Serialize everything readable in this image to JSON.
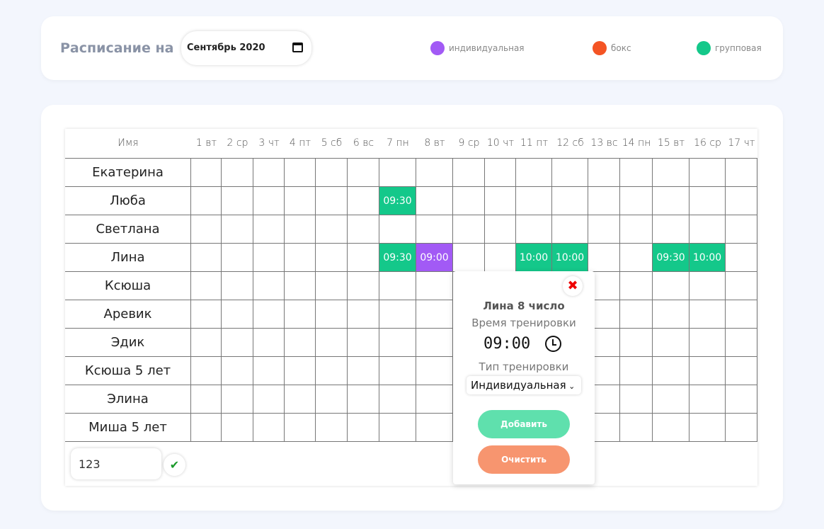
{
  "header": {
    "title": "Расписание на",
    "month_value": "Сентябрь 2020",
    "legend": [
      {
        "label": "индивидуальная",
        "color": "#a25af5"
      },
      {
        "label": "бокс",
        "color": "#f45424"
      },
      {
        "label": "групповая",
        "color": "#14c88a"
      }
    ]
  },
  "table": {
    "name_header": "Имя",
    "days": [
      "1 вт",
      "2 ср",
      "3 чт",
      "4 пт",
      "5 сб",
      "6 вс",
      "7 пн",
      "8 вт",
      "9 ср",
      "10 чт",
      "11 пт",
      "12 сб",
      "13 вс",
      "14 пн",
      "15 вт",
      "16 ср",
      "17 чт"
    ],
    "names": [
      "Екатерина",
      "Люба",
      "Светлана",
      "Лина",
      "Ксюша",
      "Аревик",
      "Эдик",
      "Ксюша 5 лет",
      "Элина",
      "Миша 5 лет"
    ],
    "entries": [
      {
        "row": 1,
        "day": 7,
        "time": "09:30",
        "type": "групповая"
      },
      {
        "row": 3,
        "day": 7,
        "time": "09:30",
        "type": "групповая"
      },
      {
        "row": 3,
        "day": 8,
        "time": "09:00",
        "type": "индивидуальная"
      },
      {
        "row": 3,
        "day": 11,
        "time": "10:00",
        "type": "групповая"
      },
      {
        "row": 3,
        "day": 12,
        "time": "10:00",
        "type": "групповая"
      },
      {
        "row": 3,
        "day": 15,
        "time": "09:30",
        "type": "групповая"
      },
      {
        "row": 3,
        "day": 16,
        "time": "10:00",
        "type": "групповая"
      }
    ]
  },
  "new_name": {
    "value": "123"
  },
  "popup": {
    "title": "Лина 8 число",
    "time_label": "Время тренировки",
    "time_value": "09:00",
    "type_label": "Тип тренировки",
    "type_value": "Индивидуальная",
    "add_label": "Добавить",
    "clear_label": "Очистить"
  }
}
